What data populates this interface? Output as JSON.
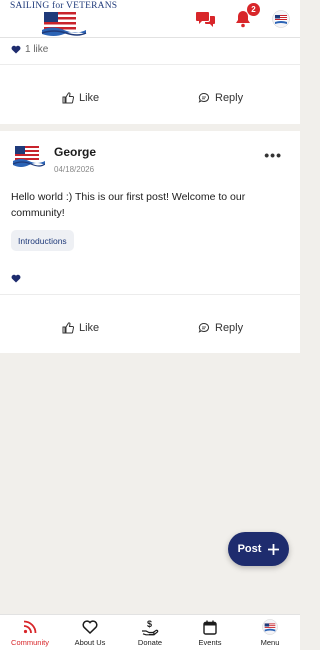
{
  "header": {
    "logo_text": "SAILING for VETERANS",
    "notification_count": "2",
    "colors": {
      "accent": "#d8262a",
      "brand": "#1e2c6e"
    }
  },
  "posts": [
    {
      "like_count": "1 like",
      "like_label": "Like",
      "reply_label": "Reply"
    },
    {
      "author": "George",
      "date": "04/18/2026",
      "text": "Hello world :) This is our first post! Welcome to our community!",
      "tag": "Introductions",
      "more": "•••",
      "like_label": "Like",
      "reply_label": "Reply"
    }
  ],
  "fab": {
    "label": "Post"
  },
  "bottom_nav": [
    {
      "label": "Community",
      "icon": "rss-icon",
      "active": true
    },
    {
      "label": "About Us",
      "icon": "heart-outline-icon"
    },
    {
      "label": "Donate",
      "icon": "donate-hand-icon"
    },
    {
      "label": "Events",
      "icon": "calendar-icon"
    },
    {
      "label": "Menu",
      "icon": "avatar-icon"
    }
  ]
}
